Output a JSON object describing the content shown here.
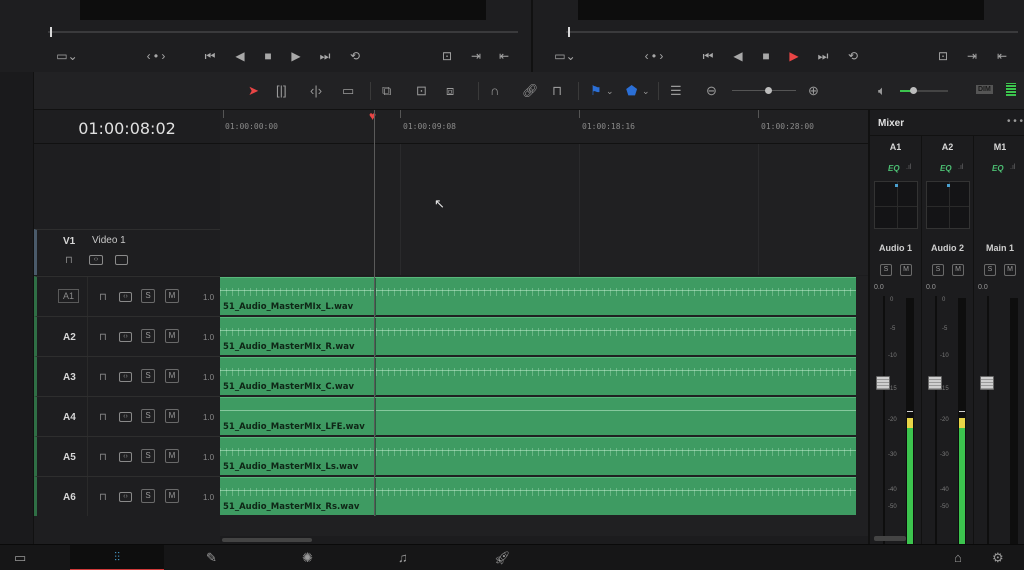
{
  "viewer": {
    "source_controls": [
      "▭⌄",
      "‹ • ›",
      "⏮",
      "◀",
      "■",
      "▶",
      "⏭",
      "⟲",
      "⊡",
      "⇥",
      "⇤"
    ],
    "timeline_controls": [
      "▭⌄",
      "‹ • ›",
      "⏮",
      "◀",
      "■",
      "▶",
      "⏭",
      "⟲",
      "⊡",
      "⇥",
      "⇤"
    ],
    "play_active_color": "#e84545"
  },
  "toolbar": {
    "icons": [
      "select-tool-icon",
      "trim-tool-icon",
      "dynamic-trim-icon",
      "blade-tool-icon",
      "insert-clip-icon",
      "overwrite-clip-icon",
      "replace-clip-icon",
      "snapping-icon",
      "linked-selection-icon",
      "position-lock-icon",
      "flag-icon",
      "marker-icon",
      "track-height-icon",
      "zoom-out-icon",
      "zoom-slider",
      "zoom-in-icon",
      "volume-icon",
      "dim-button"
    ],
    "dim_label": "DIM",
    "flag_color": "#2b6fd6",
    "marker_color": "#2b6fd6"
  },
  "timeline": {
    "timecode": "01:00:08:02",
    "ruler": [
      "01:00:00:00",
      "01:00:09:08",
      "01:00:18:16",
      "01:00:28:00"
    ],
    "video_track": {
      "id": "V1",
      "name": "Video 1"
    },
    "audio_tracks": [
      {
        "id": "A1",
        "clip": "51_Audio_MasterMIx_L.wav",
        "volume": "1.0",
        "selected_style": true
      },
      {
        "id": "A2",
        "clip": "51_Audio_MasterMIx_R.wav",
        "volume": "1.0"
      },
      {
        "id": "A3",
        "clip": "51_Audio_MasterMIx_C.wav",
        "volume": "1.0"
      },
      {
        "id": "A4",
        "clip": "51_Audio_MasterMIx_LFE.wav",
        "volume": "1.0"
      },
      {
        "id": "A5",
        "clip": "51_Audio_MasterMIx_Ls.wav",
        "volume": "1.0"
      },
      {
        "id": "A6",
        "clip": "51_Audio_MasterMIx_Rs.wav",
        "volume": "1.0"
      }
    ],
    "solo_label": "S",
    "mute_label": "M",
    "clip_color": "#3e9b62"
  },
  "mixer": {
    "title": "Mixer",
    "more_label": "• • •",
    "eq_label": "EQ",
    "channels": [
      {
        "id": "A1",
        "name": "Audio 1",
        "level_db": "0.0",
        "meter_level": 0.52
      },
      {
        "id": "A2",
        "name": "Audio 2",
        "level_db": "0.0",
        "meter_level": 0.52
      },
      {
        "id": "M1",
        "name": "Main 1",
        "level_db": "0.0",
        "meter_level": 0
      }
    ],
    "scale": [
      "0",
      "-5",
      "-10",
      "-15",
      "-20",
      "-30",
      "-40",
      "-50"
    ],
    "meter_color": "#3cc44e",
    "meter_warn_color": "#e8d548"
  },
  "bottombar": {
    "pages": [
      "media-page-icon",
      "cut-page-icon",
      "edit-page-icon",
      "fusion-page-icon",
      "color-page-icon",
      "fairlight-page-icon",
      "deliver-page-icon"
    ],
    "active_page": "fairlight-page-icon",
    "home_icon": "home-icon",
    "settings_icon": "gear-icon"
  }
}
